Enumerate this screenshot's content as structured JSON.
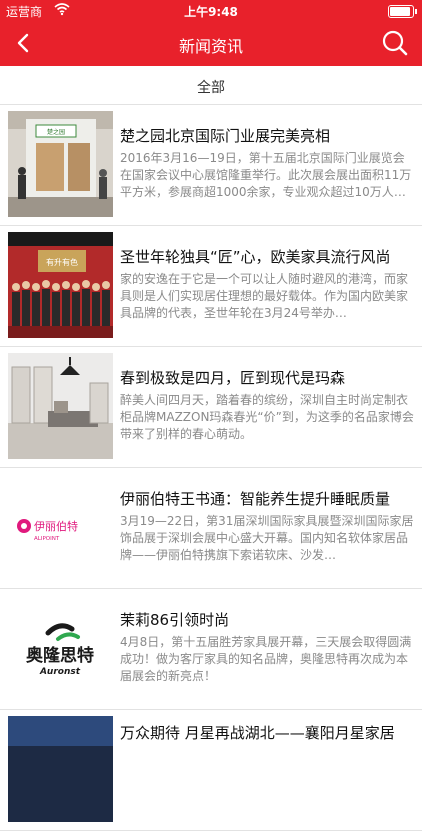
{
  "status": {
    "carrier": "运营商",
    "time": "上午9:48"
  },
  "nav": {
    "title": "新闻资讯"
  },
  "filter": {
    "label": "全部"
  },
  "news": [
    {
      "title": "楚之园北京国际门业展完美亮相",
      "desc": "2016年3月16—19日，第十五届北京国际门业展览会在国家会议中心展馆隆重举行。此次展会展出面积11万平方米，参展商超1000余家，专业观众超过10万人次…"
    },
    {
      "title": "圣世年轮独具“匠”心，欧美家具流行风尚",
      "desc": "家的安逸在于它是一个可以让人随时避风的港湾，而家具则是人们实现居住理想的最好载体。作为国内欧美家具品牌的代表，圣世年轮在3月24号举办…"
    },
    {
      "title": "春到极致是四月，匠到现代是玛森",
      "desc": "醉美人间四月天，踏着春的缤纷，深圳自主时尚定制衣柜品牌MAZZON玛森春光“价”到，为这季的名品家博会带来了别样的春心萌动。"
    },
    {
      "title": "伊丽伯特王书通：智能养生提升睡眠质量",
      "desc": "3月19—22日，第31届深圳国际家具展暨深圳国际家居饰品展于深圳会展中心盛大开幕。国内知名软体家居品牌——伊丽伯特携旗下索诺软床、沙发…",
      "logo_text": "伊丽伯特",
      "logo_sub": "ALIPOINT"
    },
    {
      "title": "茉莉86引领时尚",
      "desc": "4月8日，第十五届胜芳家具展开幕，三天展会取得圆满成功！做为客厅家具的知名品牌，奥隆思特再次成为本届展会的新亮点！",
      "logo_text": "奥隆思特",
      "logo_sub": "Auronst"
    },
    {
      "title": "万众期待 月星再战湖北——襄阳月星家居",
      "desc": ""
    }
  ],
  "booth_sign": "楚之园",
  "banner_sign": "有升有色",
  "colors": {
    "brand": "#e8212b"
  }
}
